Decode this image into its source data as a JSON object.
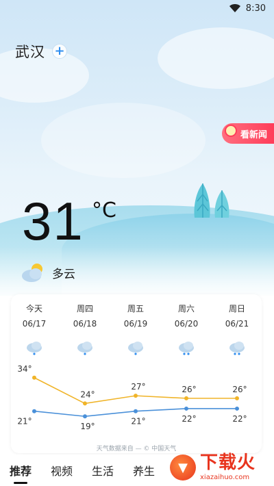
{
  "status": {
    "time": "8:30",
    "wifi_icon": "wifi-icon",
    "battery_icon": "battery-icon"
  },
  "location": {
    "city": "武汉",
    "add_label": "+"
  },
  "news_badge": {
    "label": "看新闻"
  },
  "current": {
    "temperature": "31",
    "unit": "°C",
    "condition": "多云",
    "condition_icon": "partly-cloudy-icon"
  },
  "forecast": {
    "days": [
      {
        "name": "今天",
        "date": "06/17",
        "icon": "light-rain-icon",
        "high": "34°",
        "low": "21°"
      },
      {
        "name": "周四",
        "date": "06/18",
        "icon": "light-rain-icon",
        "high": "24°",
        "low": "19°"
      },
      {
        "name": "周五",
        "date": "06/19",
        "icon": "light-rain-icon",
        "high": "27°",
        "low": "21°"
      },
      {
        "name": "周六",
        "date": "06/20",
        "icon": "moderate-rain-icon",
        "high": "26°",
        "low": "22°"
      },
      {
        "name": "周日",
        "date": "06/21",
        "icon": "moderate-rain-icon",
        "high": "26°",
        "low": "22°"
      }
    ],
    "high_color": "#f0b429",
    "low_color": "#4a90d9",
    "credit": "天气数据来自 — © 中国天气"
  },
  "chart_data": {
    "type": "line",
    "categories": [
      "06/17",
      "06/18",
      "06/19",
      "06/20",
      "06/21"
    ],
    "series": [
      {
        "values": [
          34,
          24,
          27,
          26,
          26
        ]
      },
      {
        "values": [
          21,
          19,
          21,
          22,
          22
        ]
      }
    ],
    "grid": false
  },
  "tabs": [
    {
      "label": "推荐",
      "active": true
    },
    {
      "label": "视频",
      "active": false
    },
    {
      "label": "生活",
      "active": false
    },
    {
      "label": "养生",
      "active": false
    }
  ],
  "watermark": {
    "main": "下载火",
    "sub": "xiazaihuo.com"
  }
}
